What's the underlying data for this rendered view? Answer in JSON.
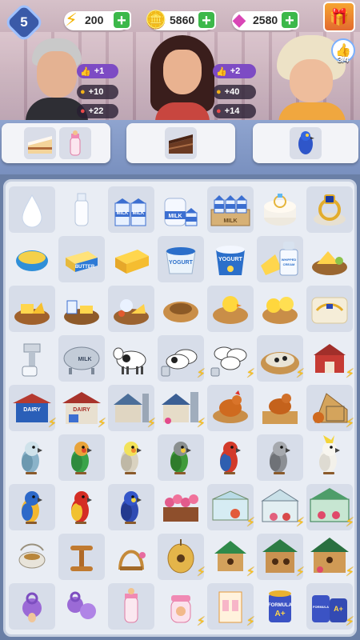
{
  "hud": {
    "level": "5",
    "energy": "200",
    "coins": "5860",
    "gems": "2580",
    "likes_progress": "3/4"
  },
  "customers": [
    {
      "name": "old-man",
      "likes": "+1",
      "coins": "+10",
      "xp": "+22"
    },
    {
      "name": "young-woman",
      "likes": "+2",
      "coins": "+40",
      "xp": "+14"
    },
    {
      "name": "old-lady"
    }
  ],
  "orders": [
    {
      "items": [
        "cake-slice",
        "baby-bottle"
      ]
    },
    {
      "items": [
        "chocolate-cake"
      ]
    },
    {
      "items": [
        "blue-parrot"
      ]
    }
  ],
  "board_rows": [
    [
      "milk-drop",
      "milk-bottle",
      "milk-cartons",
      "milk-jug",
      "milk-crate",
      "ring-cushion",
      "sapphire-ring"
    ],
    [
      "cream-bowl",
      "butter",
      "cheese-block",
      "yogurt-cup",
      "yogurt-tub",
      "whipped-cream",
      "cheese-platter"
    ],
    [
      "cheese-board",
      "dairy-board",
      "cheese-plate",
      "nest",
      "chick-nest",
      "two-chicks-nest",
      "jewelry-cushion"
    ],
    [
      "milk-separator",
      "milk-tank",
      "cow",
      "two-cows",
      "cow-herd",
      "cow-pen",
      "barn"
    ],
    [
      "dairy-stand",
      "dairy-shop",
      "farmhouse",
      "dairy-farm",
      "hen",
      "hen-nest",
      "chicken-coop"
    ],
    [
      "budgie",
      "lovebird",
      "cockatiel",
      "green-parrot",
      "red-parrot",
      "grey-parrot",
      "cockatoo"
    ],
    [
      "macaw",
      "scarlet-macaw",
      "blue-macaw",
      "flower-box",
      "small-greenhouse",
      "greenhouse",
      "big-greenhouse"
    ],
    [
      "bird-feeder",
      "bird-perch",
      "bird-swing",
      "bird-hive",
      "birdhouse",
      "birdhouse-large",
      "birdhouse-villa"
    ],
    [
      "pacifier",
      "twin-pacifiers",
      "baby-bottle",
      "sippy-cup",
      "formula-box",
      "formula-can",
      "formula-cans"
    ]
  ],
  "formula_label": "FORMULA A+",
  "milk_label": "MILK",
  "yogurt_label": "YOGURT",
  "butter_label": "BUTTER",
  "cream_label": "WHIPPED CREAM",
  "dairy_label": "DAIRY"
}
